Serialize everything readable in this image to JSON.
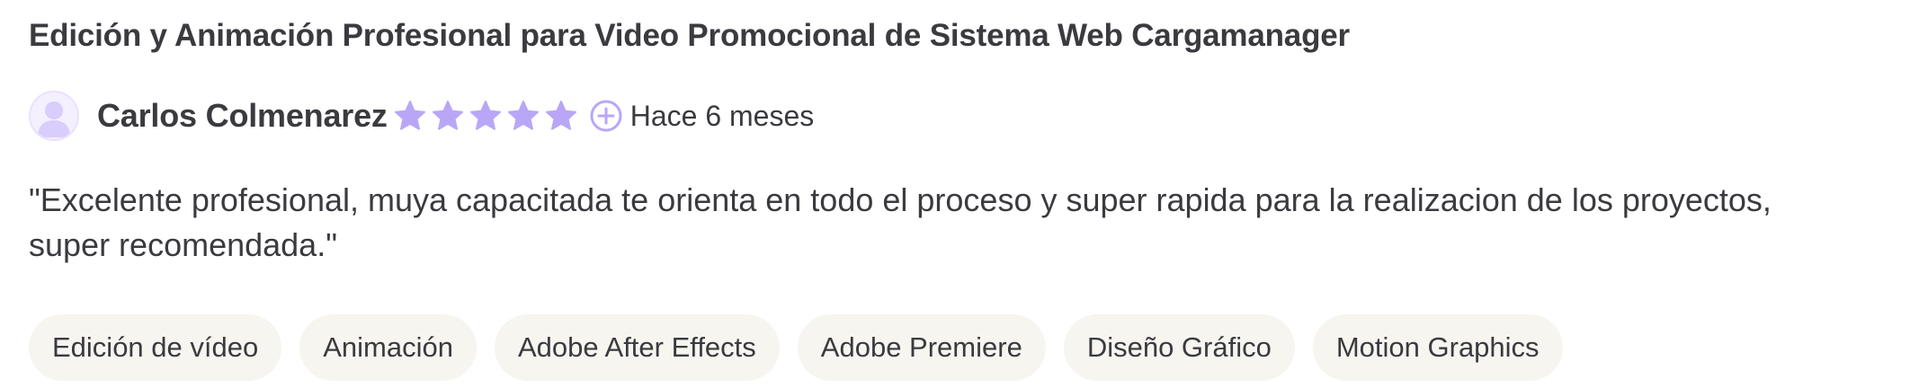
{
  "review": {
    "title": "Edición y Animación Profesional para Video Promocional de Sistema Web Cargamanager",
    "reviewer_name": "Carlos Colmenarez",
    "rating": 5,
    "rating_max": 5,
    "time_ago": "Hace 6 meses",
    "text": "\"Excelente profesional, muya capacitada te orienta en todo el proceso y super rapida para la realizacion de los proyectos, super recomendada.\"",
    "avatar_icon": "user-avatar-placeholder-icon",
    "star_icon": "star-icon",
    "time_icon": "plus-circle-icon"
  },
  "tags": [
    "Edición de vídeo",
    "Animación",
    "Adobe After Effects",
    "Adobe Premiere",
    "Diseño Gráfico",
    "Motion Graphics"
  ],
  "colors": {
    "accent": "#b9a6f7",
    "text": "#3a3a3f",
    "tag_background": "#f6f5f0"
  }
}
